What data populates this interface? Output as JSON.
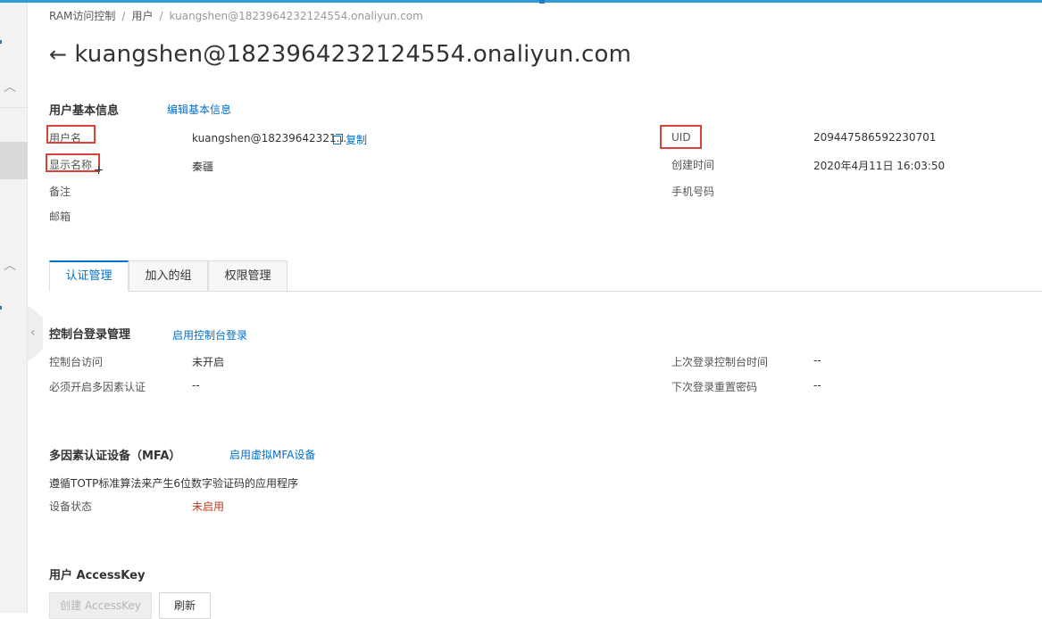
{
  "breadcrumb": {
    "items": [
      "RAM访问控制",
      "用户"
    ],
    "current": "kuangshen@1823964232124554.onaliyun.com",
    "separator": "/"
  },
  "page": {
    "back_icon": "←",
    "title": "kuangshen@1823964232124554.onaliyun.com"
  },
  "basic_info": {
    "heading": "用户基本信息",
    "edit_link": "编辑基本信息",
    "username_label": "用户名",
    "username_value": "kuangshen@18239642321...",
    "copy_label": "复制",
    "display_name_label": "显示名称",
    "display_name_value": "秦疆",
    "remark_label": "备注",
    "email_label": "邮箱",
    "uid_label": "UID",
    "uid_value": "209447586592230701",
    "created_label": "创建时间",
    "created_value": "2020年4月11日 16:03:50",
    "phone_label": "手机号码"
  },
  "tabs": [
    {
      "label": "认证管理",
      "active": true
    },
    {
      "label": "加入的组",
      "active": false
    },
    {
      "label": "权限管理",
      "active": false
    }
  ],
  "console_login": {
    "heading": "控制台登录管理",
    "enable_link": "启用控制台登录",
    "access_label": "控制台访问",
    "access_value": "未开启",
    "mfa_required_label": "必须开启多因素认证",
    "mfa_required_value": "--",
    "last_login_label": "上次登录控制台时间",
    "last_login_value": "--",
    "reset_pwd_label": "下次登录重置密码",
    "reset_pwd_value": "--"
  },
  "mfa": {
    "heading": "多因素认证设备（MFA）",
    "enable_link": "启用虚拟MFA设备",
    "description": "遵循TOTP标准算法来产生6位数字验证码的应用程序",
    "status_label": "设备状态",
    "status_value": "未启用"
  },
  "accesskey": {
    "heading": "用户 AccessKey",
    "create_button": "创建 AccessKey",
    "refresh_button": "刷新"
  },
  "colors": {
    "accent": "#0070cc",
    "highlight_box": "#d9413a",
    "status_disabled": "#c0391b",
    "top_bar": "#2e9bd6"
  },
  "icons": {
    "sidebar_chevron": "chevron-up-icon",
    "collapse": "chevron-left-icon",
    "copy": "copy-icon"
  }
}
